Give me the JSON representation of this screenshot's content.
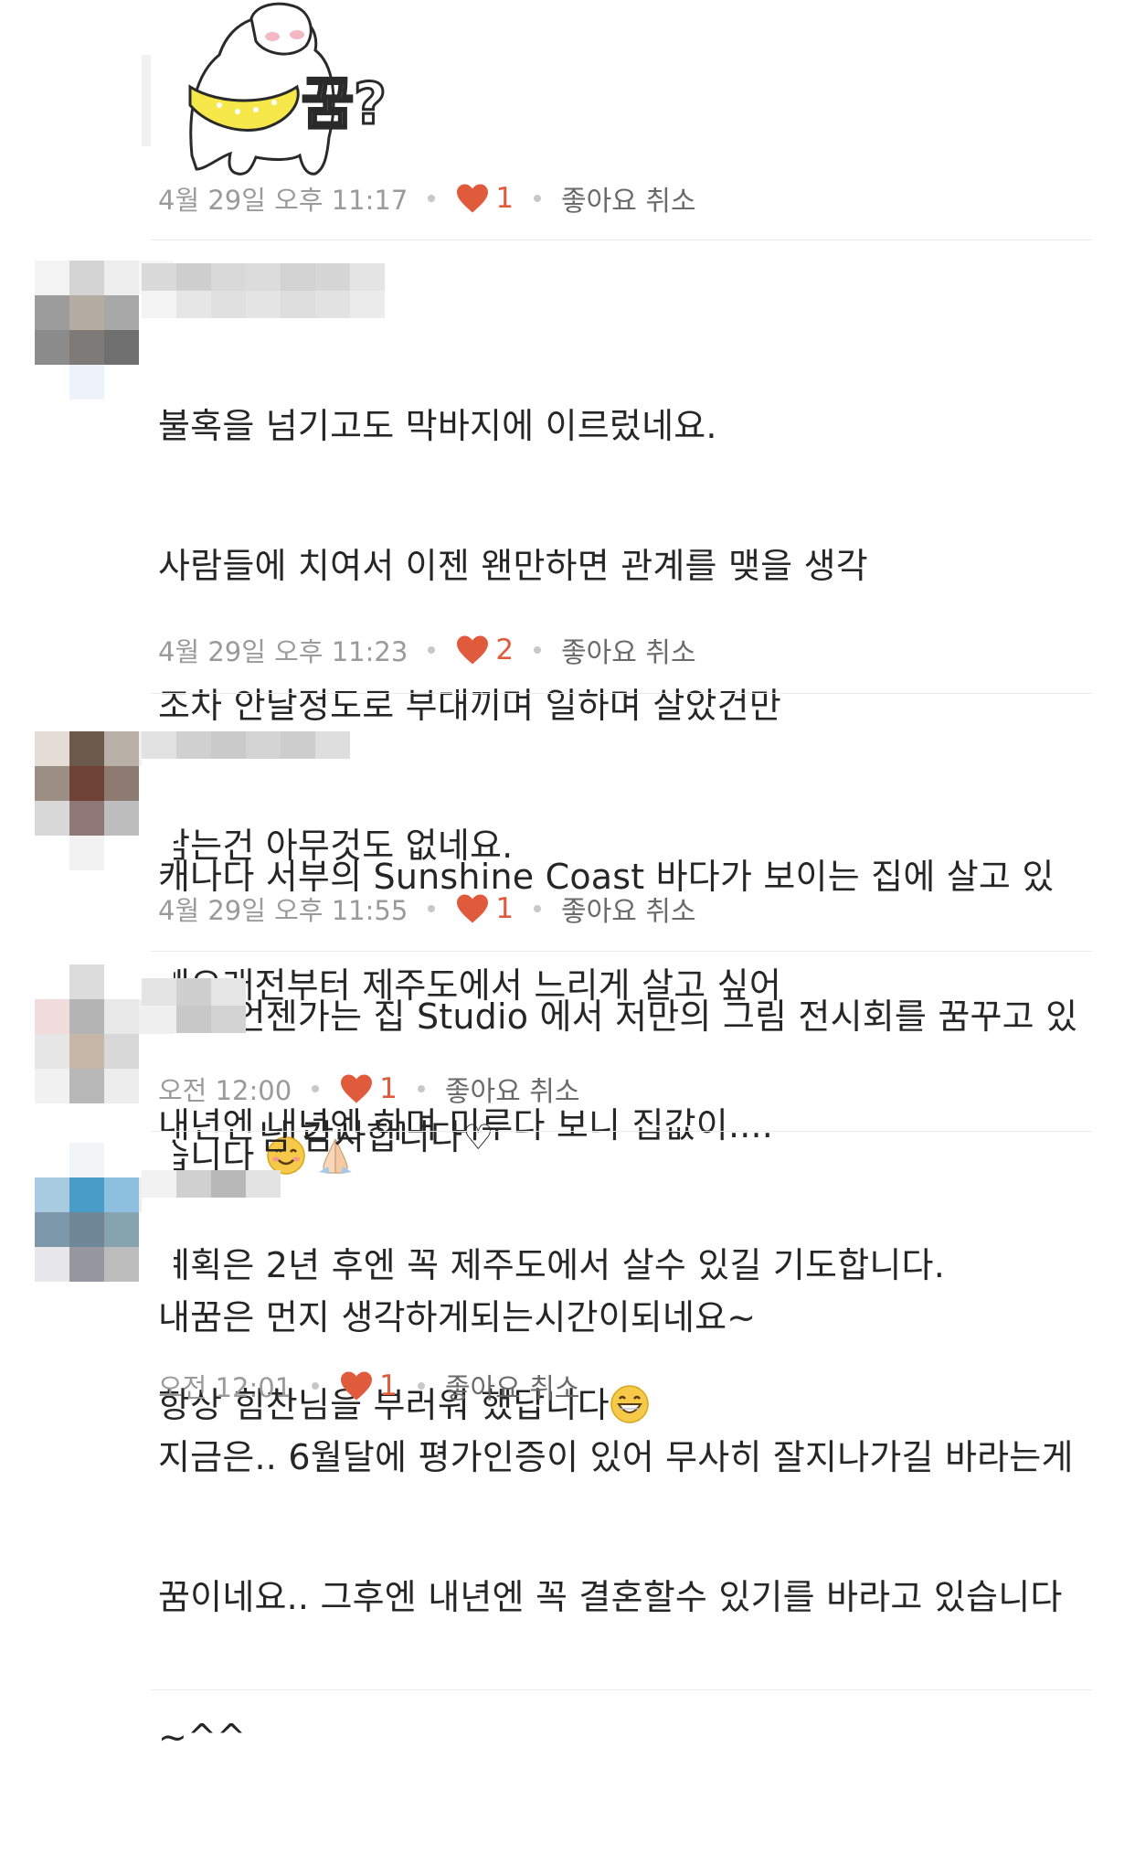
{
  "comments": [
    {
      "text": "",
      "time": "4월 29일 오후 11:17",
      "likes": "1",
      "action": "좋아요 취소",
      "sticker": {
        "text": "꿈?"
      }
    },
    {
      "text_lines": [
        "불혹을 넘기고도 막바지에 이르렀네요.",
        "사람들에 치여서 이젠 왠만하면 관계를 맺을 생각",
        "조차 안날정도로 부대끼며 일하며 살았건만",
        "남는건 아무것도 없네요.",
        "꽤오래전부터 제주도에서 느리게 살고 싶어",
        "내년엔 내년엔 하며 미루다 보니 집값이....",
        "계획은 2년 후엔 꼭 제주도에서 살수 있길 기도합니다.",
        "항상 힘찬님을 부러워 했답니다"
      ],
      "time": "4월 29일 오후 11:23",
      "likes": "2",
      "action": "좋아요 취소"
    },
    {
      "text_lines": [
        "캐나다 서부의 Sunshine Coast 바다가 보이는 집에 살고 있",
        "는데 언젠가는 집 Studio 에서 저만의 그림 전시회를 꿈꾸고 있",
        "습니다 "
      ],
      "time": "4월 29일 오후 11:55",
      "likes": "1",
      "action": "좋아요 취소"
    },
    {
      "text_lines": [
        "님 감사합니다♡"
      ],
      "time": "오전 12:00",
      "likes": "1",
      "action": "좋아요 취소"
    },
    {
      "text_lines": [
        "내꿈은 먼지 생각하게되는시간이되네요~",
        "지금은.. 6월달에 평가인증이 있어 무사히 잘지나가길 바라는게",
        "꿈이네요.. 그후엔 내년엔 꼭 결혼할수 있기를 바라고 있습니다",
        "~^^"
      ],
      "time": "오전 12:01",
      "likes": "1",
      "action": "좋아요 취소"
    }
  ],
  "colors": {
    "heart": "#e05a3c",
    "meta": "#9a9a9a",
    "text": "#262626",
    "sticker_scarf": "#f6e84a"
  },
  "icons": {
    "like": "heart-icon",
    "grin": "grinning-face-emoji",
    "smile": "smiling-face-emoji",
    "pray": "folded-hands-emoji"
  }
}
